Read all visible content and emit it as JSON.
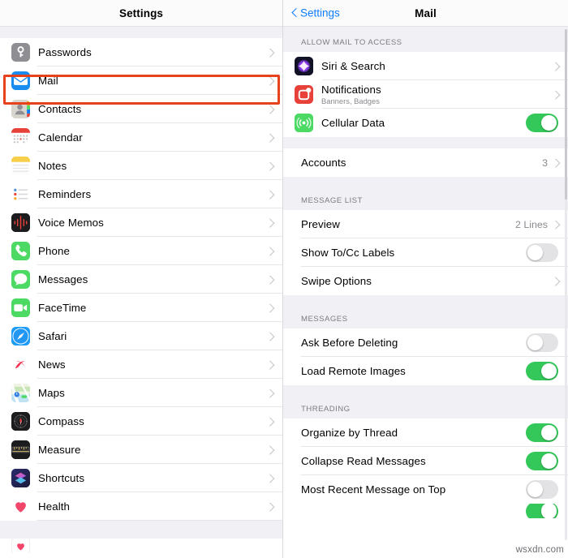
{
  "left_panel": {
    "nav_title": "Settings",
    "items": [
      {
        "label": "Passwords",
        "icon": "passwords-key-icon"
      },
      {
        "label": "Mail",
        "icon": "mail-icon",
        "highlighted": true
      },
      {
        "label": "Contacts",
        "icon": "contacts-icon"
      },
      {
        "label": "Calendar",
        "icon": "calendar-icon"
      },
      {
        "label": "Notes",
        "icon": "notes-icon"
      },
      {
        "label": "Reminders",
        "icon": "reminders-icon"
      },
      {
        "label": "Voice Memos",
        "icon": "voice-memos-icon"
      },
      {
        "label": "Phone",
        "icon": "phone-icon"
      },
      {
        "label": "Messages",
        "icon": "messages-icon"
      },
      {
        "label": "FaceTime",
        "icon": "facetime-icon"
      },
      {
        "label": "Safari",
        "icon": "safari-icon"
      },
      {
        "label": "News",
        "icon": "news-icon"
      },
      {
        "label": "Maps",
        "icon": "maps-icon"
      },
      {
        "label": "Compass",
        "icon": "compass-icon"
      },
      {
        "label": "Measure",
        "icon": "measure-icon"
      },
      {
        "label": "Shortcuts",
        "icon": "shortcuts-icon"
      },
      {
        "label": "Health",
        "icon": "health-icon"
      }
    ]
  },
  "right_panel": {
    "back_label": "Settings",
    "title": "Mail",
    "sections": [
      {
        "header": "ALLOW MAIL TO ACCESS",
        "rows": [
          {
            "label": "Siri & Search",
            "icon": "siri-icon",
            "control": "chevron"
          },
          {
            "label": "Notifications",
            "icon": "notifications-icon",
            "sublabel": "Banners, Badges",
            "control": "chevron"
          },
          {
            "label": "Cellular Data",
            "icon": "cellular-data-icon",
            "control": "toggle",
            "value": "on"
          }
        ]
      },
      {
        "header": "",
        "rows": [
          {
            "label": "Accounts",
            "control": "chevron",
            "value": "3",
            "highlighted": true
          }
        ]
      },
      {
        "header": "MESSAGE LIST",
        "rows": [
          {
            "label": "Preview",
            "control": "chevron",
            "value": "2 Lines"
          },
          {
            "label": "Show To/Cc Labels",
            "control": "toggle",
            "value": "off"
          },
          {
            "label": "Swipe Options",
            "control": "chevron"
          }
        ]
      },
      {
        "header": "MESSAGES",
        "rows": [
          {
            "label": "Ask Before Deleting",
            "control": "toggle",
            "value": "off"
          },
          {
            "label": "Load Remote Images",
            "control": "toggle",
            "value": "on"
          }
        ]
      },
      {
        "header": "THREADING",
        "rows": [
          {
            "label": "Organize by Thread",
            "control": "toggle",
            "value": "on"
          },
          {
            "label": "Collapse Read Messages",
            "control": "toggle",
            "value": "on"
          },
          {
            "label": "Most Recent Message on Top",
            "control": "toggle",
            "value": "off"
          }
        ]
      }
    ]
  },
  "watermark": "wsxdn.com",
  "colors": {
    "accent_blue": "#0a7cff",
    "toggle_on": "#34c759",
    "toggle_off": "#e3e3e6",
    "highlight_box": "#e8421d",
    "section_bg": "#f1f1f5",
    "separator": "#e6e6ea",
    "secondary_text": "#8a8a8f"
  }
}
